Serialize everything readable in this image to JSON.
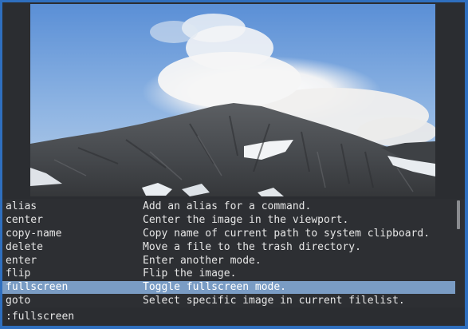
{
  "viewer": {
    "image_alt": "mountain peak with cloud"
  },
  "completions": [
    {
      "command": "alias",
      "description": "Add an alias for a command.",
      "selected": false
    },
    {
      "command": "center",
      "description": "Center the image in the viewport.",
      "selected": false
    },
    {
      "command": "copy-name",
      "description": "Copy name of current path to system clipboard.",
      "selected": false
    },
    {
      "command": "delete",
      "description": "Move a file to the trash directory.",
      "selected": false
    },
    {
      "command": "enter",
      "description": "Enter another mode.",
      "selected": false
    },
    {
      "command": "flip",
      "description": "Flip the image.",
      "selected": false
    },
    {
      "command": "fullscreen",
      "description": "Toggle fullscreen mode.",
      "selected": true
    },
    {
      "command": "goto",
      "description": "Select specific image in current filelist.",
      "selected": false
    }
  ],
  "commandline": {
    "text": ":fullscreen"
  },
  "colors": {
    "window_border": "#2f6fbf",
    "background": "#2b2d31",
    "selection": "#7a9cc4",
    "text": "#e6e6e6"
  }
}
